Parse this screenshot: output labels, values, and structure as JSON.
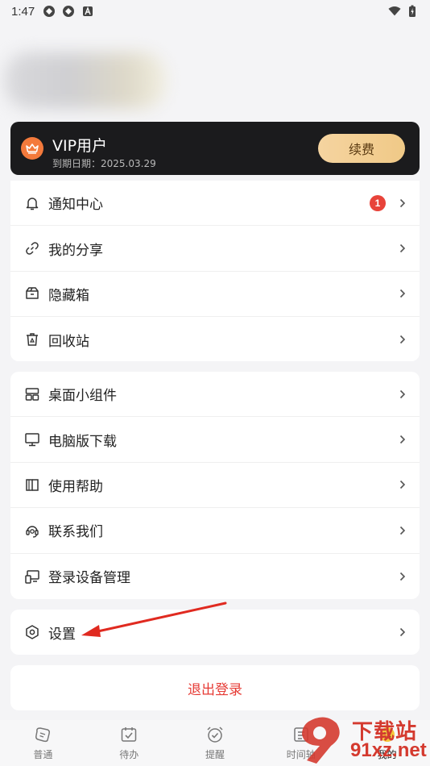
{
  "status_bar": {
    "time": "1:47"
  },
  "vip": {
    "title": "VIP用户",
    "expire": "到期日期：2025.03.29",
    "renew_label": "续费"
  },
  "section1": [
    {
      "icon": "bell-icon",
      "label": "通知中心",
      "badge": "1"
    },
    {
      "icon": "link-icon",
      "label": "我的分享"
    },
    {
      "icon": "box-icon",
      "label": "隐藏箱"
    },
    {
      "icon": "recycle-bin-icon",
      "label": "回收站"
    }
  ],
  "section2": [
    {
      "icon": "widget-icon",
      "label": "桌面小组件"
    },
    {
      "icon": "monitor-icon",
      "label": "电脑版下载"
    },
    {
      "icon": "book-icon",
      "label": "使用帮助"
    },
    {
      "icon": "headset-icon",
      "label": "联系我们"
    },
    {
      "icon": "device-icon",
      "label": "登录设备管理"
    }
  ],
  "section3": [
    {
      "icon": "hexagon-gear-icon",
      "label": "设置"
    }
  ],
  "logout_label": "退出登录",
  "bottom_nav": [
    {
      "icon": "note-icon",
      "label": "普通"
    },
    {
      "icon": "calendar-check-icon",
      "label": "待办"
    },
    {
      "icon": "alarm-icon",
      "label": "提醒"
    },
    {
      "icon": "timeline-icon",
      "label": "时间轴"
    },
    {
      "icon": "profile-icon",
      "label": "我的"
    }
  ],
  "watermark": {
    "top": "下载站",
    "bottom": "91xz.net"
  },
  "colors": {
    "accent_red": "#e63b35",
    "vip_bg": "#1b1b1d",
    "renew_gold": "#f0c987"
  }
}
